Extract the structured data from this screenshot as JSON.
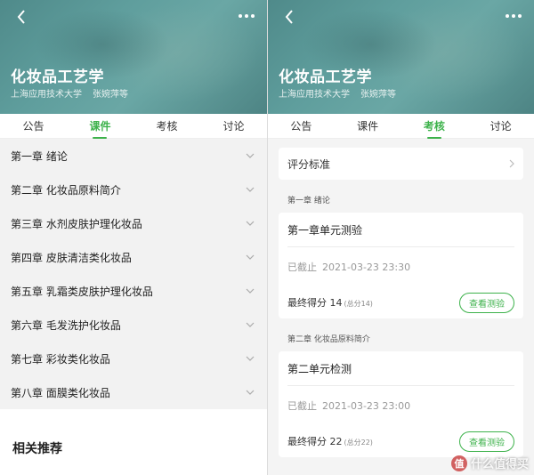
{
  "course": {
    "title": "化妆品工艺学",
    "school": "上海应用技术大学",
    "teacher": "张婉萍等"
  },
  "tabs": [
    "公告",
    "课件",
    "考核",
    "讨论"
  ],
  "left": {
    "active_tab": "课件",
    "chapters": [
      "第一章 绪论",
      "第二章 化妆品原料简介",
      "第三章 水剂皮肤护理化妆品",
      "第四章 皮肤清洁类化妆品",
      "第五章 乳霜类皮肤护理化妆品",
      "第六章 毛发洗护化妆品",
      "第七章 彩妆类化妆品",
      "第八章 面膜类化妆品"
    ],
    "related_title": "相关推荐"
  },
  "right": {
    "active_tab": "考核",
    "grading_label": "评分标准",
    "sections": [
      {
        "label": "第一章 绪论",
        "quiz_title": "第一章单元测验",
        "deadline_label": "已截止",
        "deadline": "2021-03-23 23:30",
        "score_label": "最终得分 14",
        "total": "(总分14)",
        "button": "查看测验"
      },
      {
        "label": "第二章 化妆品原料简介",
        "quiz_title": "第二单元检测",
        "deadline_label": "已截止",
        "deadline": "2021-03-23 23:00",
        "score_label": "最终得分 22",
        "total": "(总分22)",
        "button": "查看测验"
      }
    ]
  },
  "watermark": "什么值得买",
  "colors": {
    "accent": "#3db24b",
    "hero": "#5f9e9d"
  },
  "icons": {
    "back": "chevron-left-icon",
    "more": "more-dots-icon",
    "chapter": "chevron-down-icon"
  }
}
